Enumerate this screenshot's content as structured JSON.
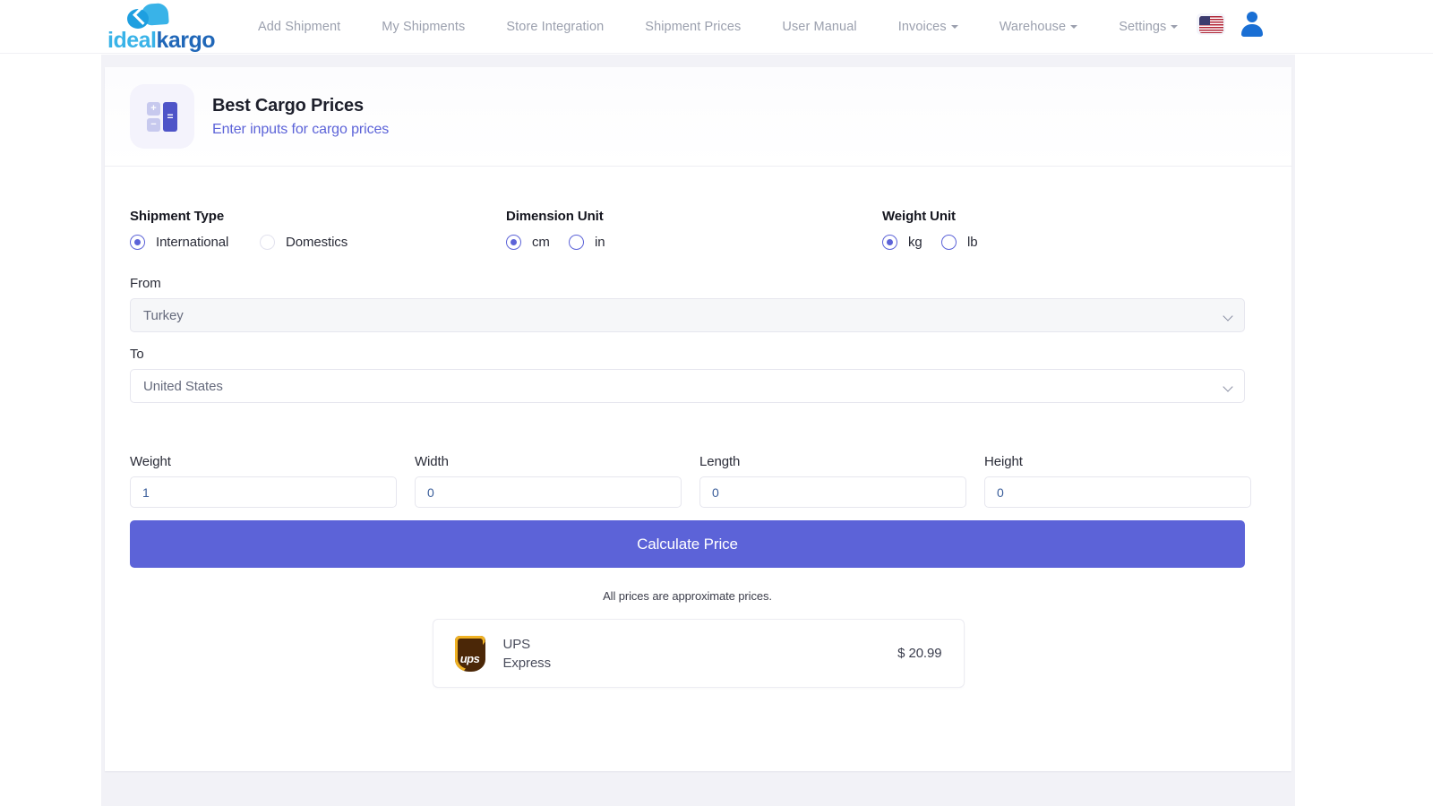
{
  "navbar": {
    "brand": {
      "part1": "ideal",
      "part2": "kargo"
    },
    "links": [
      {
        "label": "Add Shipment",
        "dropdown": false
      },
      {
        "label": "My Shipments",
        "dropdown": false
      },
      {
        "label": "Store Integration",
        "dropdown": false
      },
      {
        "label": "Shipment Prices",
        "dropdown": false
      },
      {
        "label": "User Manual",
        "dropdown": false
      },
      {
        "label": "Invoices",
        "dropdown": true
      },
      {
        "label": "Warehouse",
        "dropdown": true
      },
      {
        "label": "Settings",
        "dropdown": true
      }
    ],
    "language_flag": "us-flag-icon",
    "account_icon": "user-avatar-icon"
  },
  "card": {
    "icon": "calculator-icon",
    "icon_glyphs": {
      "plus": "+",
      "minus": "−",
      "equals": "="
    },
    "title": "Best Cargo Prices",
    "subtitle": "Enter inputs for cargo prices"
  },
  "form": {
    "shipment_type": {
      "label": "Shipment Type",
      "options": [
        {
          "label": "International",
          "selected": true,
          "style": "selected"
        },
        {
          "label": "Domestics",
          "selected": false,
          "style": "gray"
        }
      ]
    },
    "dimension_unit": {
      "label": "Dimension Unit",
      "options": [
        {
          "label": "cm",
          "selected": true,
          "style": "selected"
        },
        {
          "label": "in",
          "selected": false,
          "style": "blue"
        }
      ]
    },
    "weight_unit": {
      "label": "Weight Unit",
      "options": [
        {
          "label": "kg",
          "selected": true,
          "style": "selected"
        },
        {
          "label": "lb",
          "selected": false,
          "style": "blue"
        }
      ]
    },
    "from": {
      "label": "From",
      "value": "Turkey",
      "disabled": true
    },
    "to": {
      "label": "To",
      "value": "United States",
      "disabled": false
    },
    "measures": [
      {
        "label": "Weight",
        "value": "1"
      },
      {
        "label": "Width",
        "value": "0"
      },
      {
        "label": "Length",
        "value": "0"
      },
      {
        "label": "Height",
        "value": "0"
      }
    ],
    "calculate_button": "Calculate Price"
  },
  "results": {
    "disclaimer": "All prices are approximate prices.",
    "items": [
      {
        "logo": "ups-logo-icon",
        "logo_text": "ups",
        "carrier": "UPS",
        "service": "Express",
        "price": "$ 20.99"
      }
    ]
  },
  "colors": {
    "accent": "#5c63d8",
    "brand_light": "#39b3e8",
    "brand_dark": "#2067b8",
    "page_bg": "#f2f2f7",
    "ups_gold": "#f0b224",
    "ups_brown": "#4b2707"
  }
}
